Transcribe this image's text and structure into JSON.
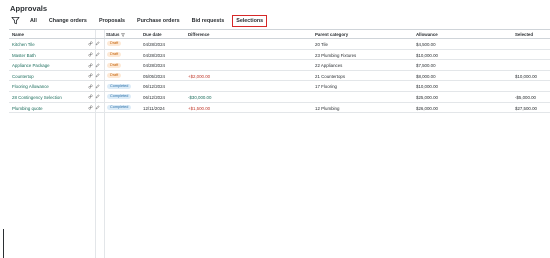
{
  "page": {
    "title": "Approvals"
  },
  "tabs": [
    {
      "label": "All"
    },
    {
      "label": "Change orders"
    },
    {
      "label": "Proposals"
    },
    {
      "label": "Purchase orders"
    },
    {
      "label": "Bid requests"
    },
    {
      "label": "Selections",
      "active": true
    }
  ],
  "table": {
    "headers": {
      "name": "Name",
      "status": "Status",
      "due_date": "Due date",
      "difference": "Difference",
      "parent_category": "Parent category",
      "allowance": "Allowance",
      "selected": "Selected"
    },
    "rows": [
      {
        "name": "Kitchen Tile",
        "status": "Draft",
        "due_date": "04/28/2024",
        "difference": "",
        "parent_category": "20 Tile",
        "allowance": "$4,500.00",
        "selected": ""
      },
      {
        "name": "Master Bath",
        "status": "Draft",
        "due_date": "04/28/2024",
        "difference": "",
        "parent_category": "23 Plumbing Fixtures",
        "allowance": "$10,000.00",
        "selected": ""
      },
      {
        "name": "Appliance Package",
        "status": "Draft",
        "due_date": "04/28/2024",
        "difference": "",
        "parent_category": "22 Appliances",
        "allowance": "$7,500.00",
        "selected": ""
      },
      {
        "name": "Countertop",
        "status": "Draft",
        "due_date": "05/05/2024",
        "difference": "+$2,000.00",
        "parent_category": "21 Countertops",
        "allowance": "$8,000.00",
        "selected": "$10,000.00"
      },
      {
        "name": "Flooring Allowance",
        "status": "Completed",
        "due_date": "06/12/2024",
        "difference": "",
        "parent_category": "17 Flooring",
        "allowance": "$10,000.00",
        "selected": ""
      },
      {
        "name": "28 Contingency Selection",
        "status": "Completed",
        "due_date": "06/12/2024",
        "difference": "-$30,000.00",
        "parent_category": "",
        "allowance": "$25,000.00",
        "selected": "-$5,000.00"
      },
      {
        "name": "Plumbing quote",
        "status": "Completed",
        "due_date": "12/11/2024",
        "difference": "+$1,500.00",
        "parent_category": "12 Plumbing",
        "allowance": "$26,000.00",
        "selected": "$27,500.00"
      }
    ]
  },
  "colors": {
    "accent": "#1b6d5c",
    "highlight_border": "#d62828",
    "draft_bg": "#fde9d6",
    "completed_bg": "#dcecf8"
  },
  "icons": {
    "filter": "filter-icon",
    "row_link": "link-icon",
    "row_edit": "edit-icon",
    "status_filter": "filter-icon"
  }
}
